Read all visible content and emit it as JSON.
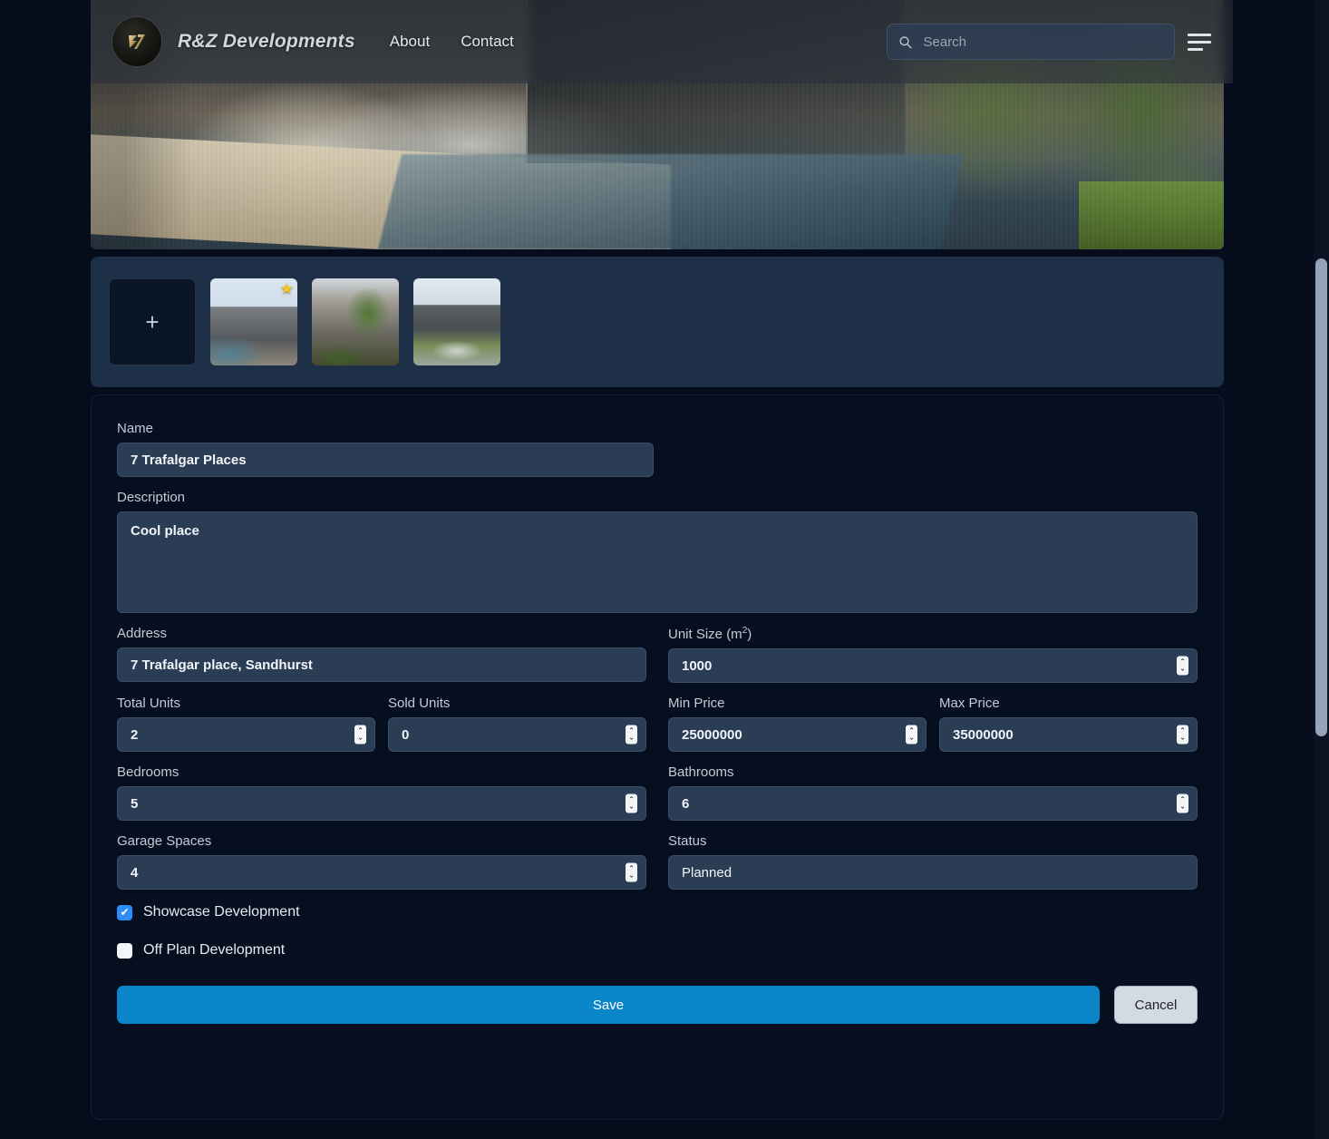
{
  "header": {
    "logo_icon": "rz-monogram-logo",
    "brand": "R&Z Developments",
    "nav": [
      {
        "label": "About"
      },
      {
        "label": "Contact"
      }
    ],
    "search": {
      "icon": "search-icon",
      "value": "",
      "placeholder": "Search"
    },
    "menu_icon": "hamburger-menu-icon"
  },
  "gallery": {
    "add_button_label": "+",
    "thumbnails": [
      {
        "alt": "development-exterior-pool",
        "featured": true,
        "star": "★"
      },
      {
        "alt": "development-facade-trees",
        "featured": false,
        "star": ""
      },
      {
        "alt": "development-lawn-pathway",
        "featured": false,
        "star": ""
      }
    ]
  },
  "form": {
    "name": {
      "label": "Name",
      "value": "7 Trafalgar Places"
    },
    "description": {
      "label": "Description",
      "value": "Cool place"
    },
    "address": {
      "label": "Address",
      "value": "7 Trafalgar place, Sandhurst"
    },
    "unit_size": {
      "label_main": "Unit Size (m",
      "label_sup": "2",
      "label_end": ")",
      "value": "1000"
    },
    "total_units": {
      "label": "Total Units",
      "value": "2"
    },
    "sold_units": {
      "label": "Sold Units",
      "value": "0"
    },
    "min_price": {
      "label": "Min Price",
      "value": "25000000"
    },
    "max_price": {
      "label": "Max Price",
      "value": "35000000"
    },
    "bedrooms": {
      "label": "Bedrooms",
      "value": "5"
    },
    "bathrooms": {
      "label": "Bathrooms",
      "value": "6"
    },
    "garage_spaces": {
      "label": "Garage Spaces",
      "value": "4"
    },
    "status": {
      "label": "Status",
      "value": "Planned"
    },
    "showcase": {
      "label": "Showcase Development",
      "checked": true,
      "mark": "✔"
    },
    "off_plan": {
      "label": "Off Plan Development",
      "checked": false,
      "mark": ""
    },
    "save_label": "Save",
    "cancel_label": "Cancel",
    "spinner_up": "⌃",
    "spinner_down": "⌄"
  },
  "colors": {
    "accent_blue": "#0b86c9",
    "checkbox_blue": "#2d8cf5",
    "input_bg": "#2b3d55",
    "page_bg": "#050d1c",
    "star_yellow": "#f5c518"
  }
}
